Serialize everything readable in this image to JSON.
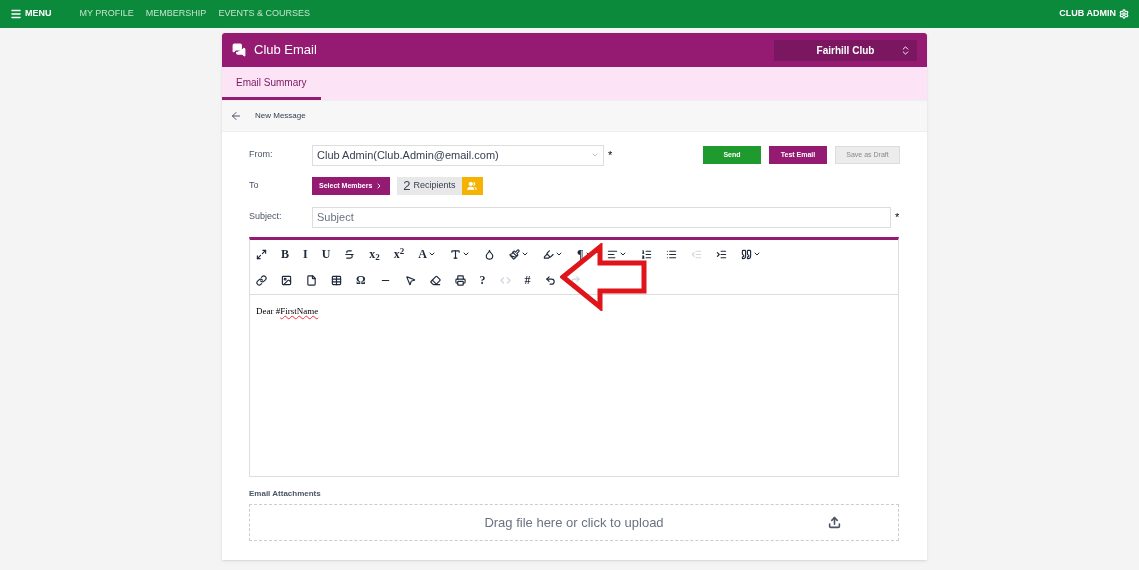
{
  "topbar": {
    "menu": "MENU",
    "links": [
      "MY PROFILE",
      "MEMBERSHIP",
      "EVENTS & COURSES"
    ],
    "user": "CLUB ADMIN"
  },
  "card": {
    "title": "Club Email",
    "club_select": "Fairhill Club"
  },
  "tabs": [
    {
      "label": "Email Summary",
      "selected": true
    }
  ],
  "subheader": {
    "title": "New Message"
  },
  "form": {
    "from_label": "From:",
    "from_value": "Club Admin(Club.Admin@email.com)",
    "to_label": "To",
    "subject_label": "Subject:",
    "subject_placeholder": "Subject",
    "required_mark": "*",
    "select_members": "Select Members",
    "recipients_count": "2",
    "recipients_label": "Recipients",
    "buttons": [
      {
        "label": "Send",
        "kind": "send",
        "disabled": false
      },
      {
        "label": "Test Email",
        "kind": "test",
        "disabled": false
      },
      {
        "label": "Save as Draft",
        "kind": "draft",
        "disabled": true
      }
    ]
  },
  "toolbar": [
    [
      {
        "kind": "icon",
        "dropdown": false,
        "disabled": false
      },
      {
        "kind": "text",
        "label": "B",
        "dropdown": false,
        "disabled": false
      },
      {
        "kind": "text",
        "label": "I",
        "dropdown": false,
        "disabled": false
      },
      {
        "kind": "text",
        "label": "U",
        "dropdown": false,
        "disabled": false
      },
      {
        "kind": "icon",
        "dropdown": false,
        "disabled": false
      },
      {
        "kind": "text",
        "label": "x$_{2}$",
        "dropdown": false,
        "disabled": false
      },
      {
        "kind": "text",
        "label": "x$^{2}$",
        "dropdown": false,
        "disabled": false
      },
      {
        "kind": "text",
        "label": "A",
        "dropdown": true,
        "disabled": false
      },
      {
        "kind": "icon",
        "dropdown": true,
        "disabled": false
      },
      {
        "kind": "icon",
        "dropdown": false,
        "disabled": false
      },
      {
        "kind": "icon",
        "dropdown": true,
        "disabled": false
      },
      {
        "kind": "icon",
        "dropdown": true,
        "disabled": false
      },
      {
        "kind": "text",
        "label": "¶",
        "dropdown": true,
        "disabled": false
      },
      {
        "kind": "icon",
        "dropdown": true,
        "disabled": false
      },
      {
        "kind": "icon",
        "dropdown": false,
        "disabled": false
      },
      {
        "kind": "icon",
        "dropdown": false,
        "disabled": false
      },
      {
        "kind": "icon",
        "dropdown": false,
        "disabled": true
      },
      {
        "kind": "icon",
        "dropdown": false,
        "disabled": false
      },
      {
        "kind": "icon",
        "dropdown": true,
        "disabled": false
      }
    ],
    [
      {
        "kind": "icon",
        "dropdown": false,
        "disabled": false
      },
      {
        "kind": "icon",
        "dropdown": false,
        "disabled": false
      },
      {
        "kind": "icon",
        "dropdown": false,
        "disabled": false
      },
      {
        "kind": "icon",
        "dropdown": false,
        "disabled": false
      },
      {
        "kind": "text",
        "label": "Ω",
        "dropdown": false,
        "disabled": false
      },
      {
        "kind": "icon",
        "dropdown": false,
        "disabled": false
      },
      {
        "kind": "icon",
        "dropdown": false,
        "disabled": false
      },
      {
        "kind": "icon",
        "dropdown": false,
        "disabled": false
      },
      {
        "kind": "icon",
        "dropdown": false,
        "disabled": false
      },
      {
        "kind": "text",
        "label": "?",
        "dropdown": false,
        "disabled": false
      },
      {
        "kind": "icon",
        "dropdown": false,
        "disabled": true
      },
      {
        "kind": "text",
        "label": "#",
        "dropdown": false,
        "disabled": false
      },
      {
        "kind": "icon",
        "dropdown": false,
        "disabled": false
      },
      {
        "kind": "icon",
        "dropdown": false,
        "disabled": true
      }
    ]
  ],
  "editor": {
    "greeting": "Dear #",
    "merge_field": "FirstName"
  },
  "attachments": {
    "label": "Email Attachments",
    "dropzone": "Drag file here or click to upload"
  },
  "annotation": {
    "kind": "arrow"
  }
}
